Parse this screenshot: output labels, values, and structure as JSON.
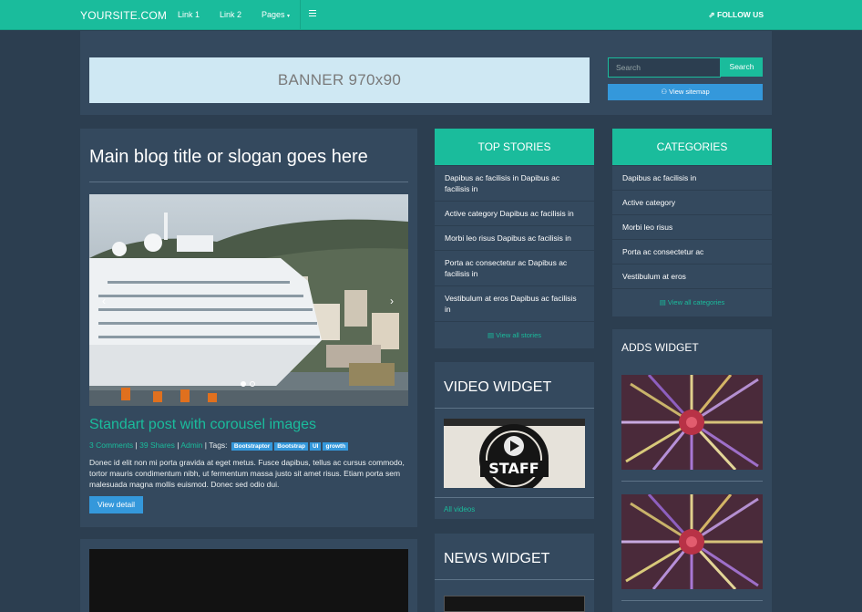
{
  "nav": {
    "brand": "YOURSITE.COM",
    "links": [
      "Link 1",
      "Link 2",
      "Pages"
    ],
    "follow": "FOLLOW US",
    "accent": "#1abc9c"
  },
  "header": {
    "banner": "BANNER 970x90",
    "search_placeholder": "Search",
    "search_button": "Search",
    "sitemap": "View sitemap"
  },
  "post": {
    "title": "Main blog title or slogan goes here",
    "subtitle": "Standart post with corousel images",
    "comments": "3 Comments",
    "shares": "39 Shares",
    "author": "Admin",
    "tags_label": "Tags:",
    "tags": [
      "Bootstraptor",
      "Bootstrap",
      "UI",
      "growth"
    ],
    "excerpt": "Donec id elit non mi porta gravida at eget metus. Fusce dapibus, tellus ac cursus commodo, tortor mauris condimentum nibh, ut fermentum massa justo sit amet risus. Etiam porta sem malesuada magna mollis euismod. Donec sed odio dui.",
    "button": "View detail"
  },
  "top_stories": {
    "title": "TOP STORIES",
    "items": [
      "Dapibus ac facilisis in Dapibus ac facilisis in",
      "Active category Dapibus ac facilisis in",
      "Morbi leo risus Dapibus ac facilisis in",
      "Porta ac consectetur ac Dapibus ac facilisis in",
      "Vestibulum at eros Dapibus ac facilisis in"
    ],
    "footer": "View all stories"
  },
  "categories": {
    "title": "CATEGORIES",
    "items": [
      "Dapibus ac facilisis in",
      "Active category",
      "Morbi leo risus",
      "Porta ac consectetur ac",
      "Vestibulum at eros"
    ],
    "footer": "View all categories"
  },
  "video_widget": {
    "title": "VIDEO WIDGET",
    "thumb_text": "STAFF",
    "footer": "All videos"
  },
  "news_widget": {
    "title": "NEWS WIDGET"
  },
  "adds_widget": {
    "title": "ADDS WIDGET"
  }
}
